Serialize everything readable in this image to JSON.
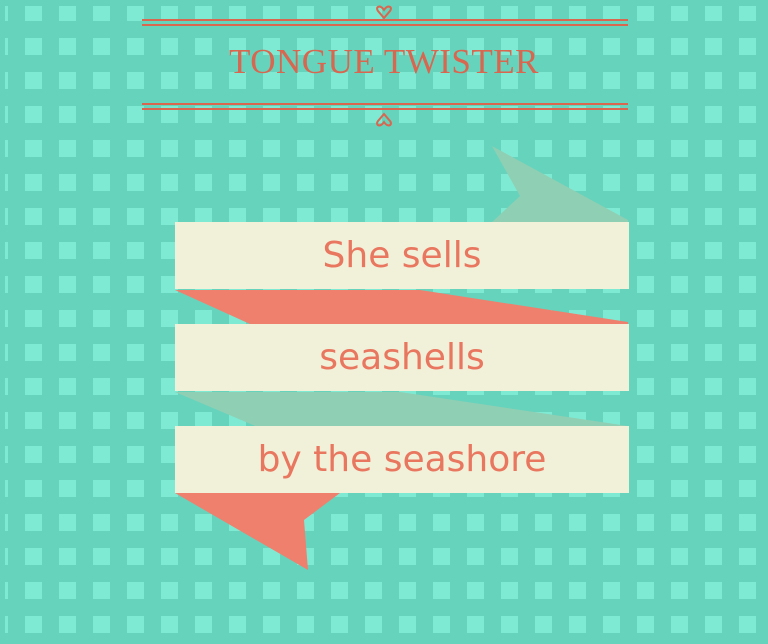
{
  "title": "TONGUE TWISTER",
  "lines": [
    "She sells",
    "seashells",
    "by the seashore"
  ],
  "colors": {
    "background": "#66d3bd",
    "square": "#7fead3",
    "accent": "#d9664f",
    "ribbon_salmon": "#ef806d",
    "ribbon_green": "#8fcfb3",
    "band": "#f1f0d9",
    "text": "#e9765f"
  },
  "icons": [
    "heart-icon-top",
    "heart-icon-bottom"
  ]
}
